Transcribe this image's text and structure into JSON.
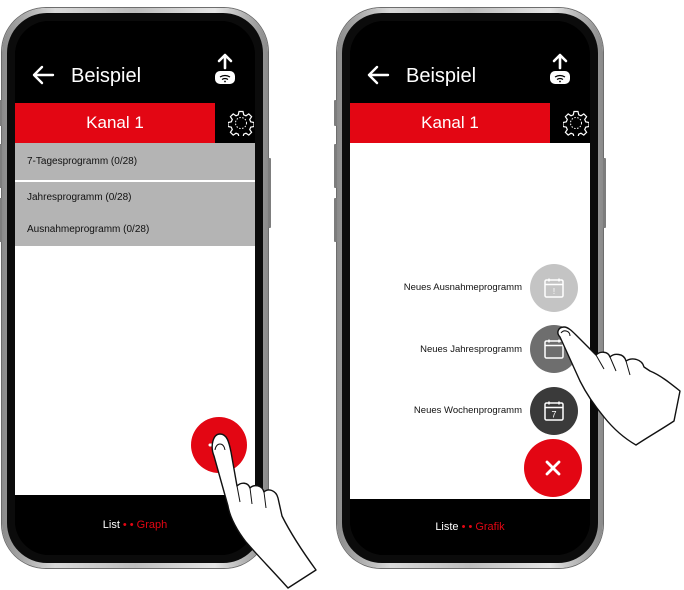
{
  "left_phone": {
    "app_title": "Beispiel",
    "channel_tab": "Kanal 1",
    "list_items": [
      "7-Tagesprogramm (0/28)",
      "Jahresprogramm (0/28)",
      "Ausnahmeprogramm (0/28)"
    ],
    "bottom_nav": {
      "list_label": "List",
      "separator": "• •",
      "graph_label": "Graph"
    }
  },
  "right_phone": {
    "app_title": "Beispiel",
    "channel_tab": "Kanal 1",
    "menu_items": [
      {
        "label": "Neues Ausnahmeprogramm",
        "icon": "calendar-exclamation-icon",
        "glyph": "!",
        "color": "#c4c4c4"
      },
      {
        "label": "Neues Jahresprogramm",
        "icon": "calendar-icon",
        "glyph": "",
        "color": "#6e6e6e"
      },
      {
        "label": "Neues Wochenprogramm",
        "icon": "calendar-7-icon",
        "glyph": "7",
        "color": "#3a3a3a"
      }
    ],
    "bottom_nav": {
      "list_label": "Liste",
      "separator": "• •",
      "graph_label": "Grafik"
    }
  },
  "colors": {
    "accent": "#e30613",
    "list_bg": "#b4b4b4",
    "bar_bg": "#000000"
  }
}
